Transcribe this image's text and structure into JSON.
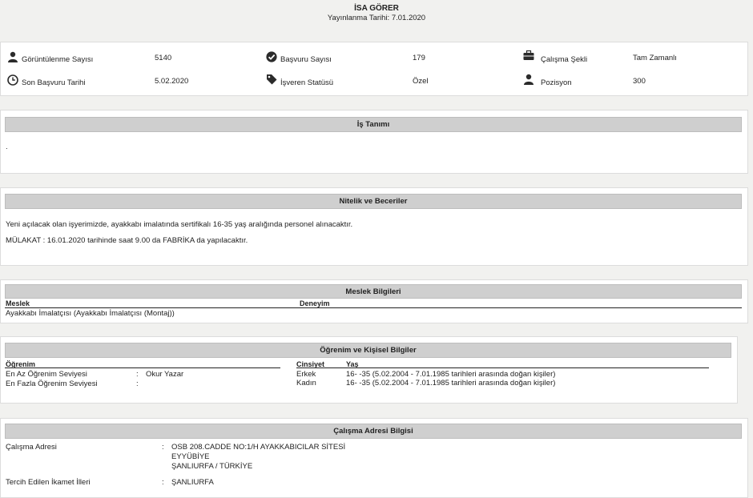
{
  "header": {
    "title": "İSA GÖRER",
    "published": "Yayınlanma Tarihi: 7.01.2020"
  },
  "stats": {
    "views_label": "Görüntülenme Sayısı",
    "views_value": "5140",
    "applications_label": "Başvuru Sayısı",
    "applications_value": "179",
    "work_type_label": "Çalışma Şekli",
    "work_type_value": "Tam Zamanlı",
    "deadline_label": "Son Başvuru Tarihi",
    "deadline_value": "5.02.2020",
    "employer_label": "İşveren Statüsü",
    "employer_value": "Özel",
    "position_label": "Pozisyon",
    "position_value": "300"
  },
  "job_description": {
    "title": "İş Tanımı",
    "text": "."
  },
  "qualifications": {
    "title": "Nitelik ve Beceriler",
    "line1": "Yeni açılacak olan işyerimizde, ayakkabı imalatında  sertifikalı 16-35 yaş aralığında personel alınacaktır.",
    "line2": "MÜLAKAT : 16.01.2020  tarihinde saat 9.00 da FABRİKA da yapılacaktır."
  },
  "profession": {
    "title": "Meslek Bilgileri",
    "col_profession": "Meslek",
    "col_experience": "Deneyim",
    "row_profession": "Ayakkabı İmalatçısı (Ayakkabı İmalatçısı (Montaj))",
    "row_experience": ""
  },
  "education": {
    "title": "Öğrenim ve Kişisel Bilgiler",
    "col_education": "Öğrenim",
    "min_label": "En Az Öğrenim Seviyesi",
    "min_value": "Okur Yazar",
    "max_label": "En Fazla Öğrenim Seviyesi",
    "max_value": "",
    "col_gender": "Cinsiyet",
    "col_age": "Yaş",
    "rows": [
      {
        "gender": "Erkek",
        "age": "16- -35 (5.02.2004 - 7.01.1985 tarihleri arasında doğan kişiler)"
      },
      {
        "gender": "Kadın",
        "age": "16- -35 (5.02.2004 - 7.01.1985 tarihleri arasında doğan kişiler)"
      }
    ],
    "colon": ":"
  },
  "address": {
    "title": "Çalışma Adresi Bilgisi",
    "address_label": "Çalışma Adresi",
    "address_line1": "OSB 208.CADDE NO:1/H AYAKKABICILAR SİTESİ",
    "address_line2": "EYYÜBİYE",
    "address_line3": "ŞANLIURFA / TÜRKİYE",
    "residence_label": "Tercih Edilen İkamet İlleri",
    "residence_value": "ŞANLIURFA",
    "colon": ":"
  },
  "colors": {
    "page_bg": "#f1f1ef",
    "panel_bg": "#ffffff",
    "section_bar": "#cfcfcf"
  },
  "icons": [
    "user-icon",
    "check-circle-icon",
    "briefcase-icon",
    "clock-icon",
    "tag-icon"
  ]
}
